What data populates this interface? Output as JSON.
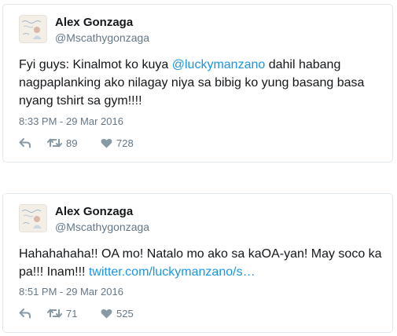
{
  "tweets": [
    {
      "name": "Alex Gonzaga",
      "handle": "@Mscathygonzaga",
      "text_before": "Fyi guys: Kinalmot ko kuya ",
      "mention": "@luckymanzano",
      "text_after": " dahil habang nagpaplanking ako nilagay niya sa bibig ko yung basang basa nyang tshirt sa gym!!!!",
      "timestamp": "8:33 PM - 29 Mar 2016",
      "retweets": "89",
      "likes": "728"
    },
    {
      "name": "Alex Gonzaga",
      "handle": "@Mscathygonzaga",
      "text_before": "Hahahahaha!! OA mo! Natalo mo ako sa kaOA-yan! May soco ka pa!!! Inam!!! ",
      "link": "twitter.com/luckymanzano/s…",
      "timestamp": "8:51 PM - 29 Mar 2016",
      "retweets": "71",
      "likes": "525"
    }
  ],
  "icons": {
    "reply": "reply-icon",
    "retweet": "retweet-icon",
    "like": "heart-icon"
  },
  "colors": {
    "link": "#1b95e0",
    "secondary_text": "#657786",
    "icon": "#8899a6",
    "border": "#e1e8ed"
  }
}
